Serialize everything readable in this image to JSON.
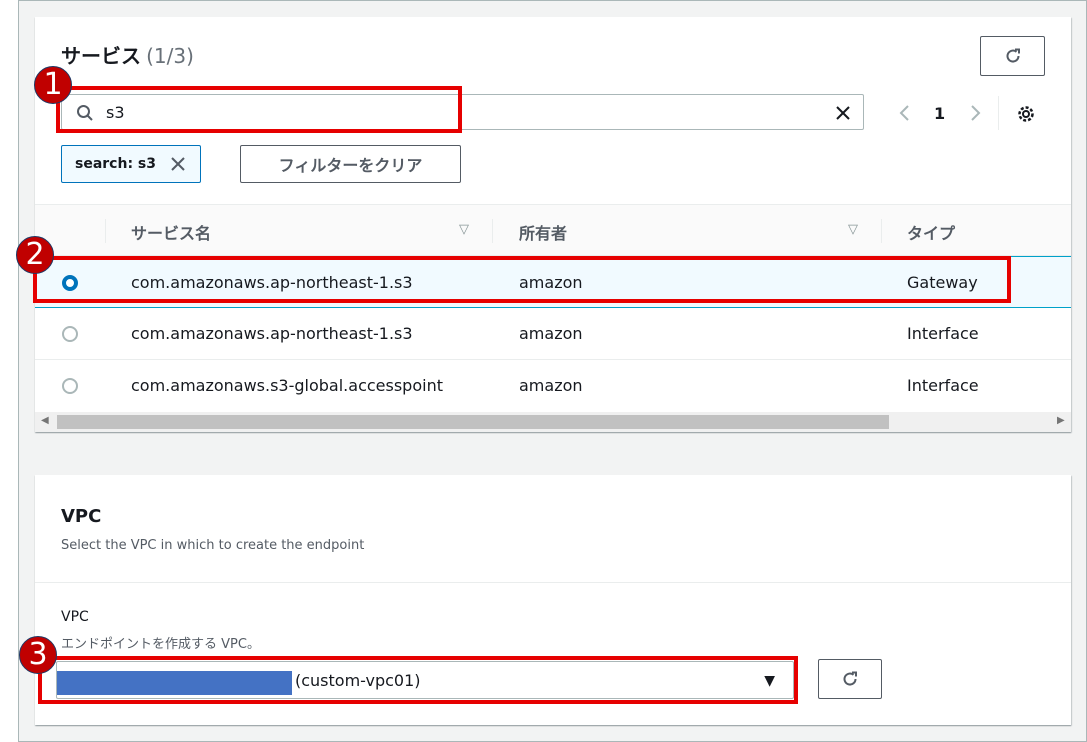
{
  "services_panel": {
    "title": "サービス",
    "count": "(1/3)",
    "search_value": "s3",
    "page_number": "1",
    "filter_tag": "search: s3",
    "clear_filters_label": "フィルターをクリア",
    "columns": [
      "サービス名",
      "所有者",
      "タイプ"
    ],
    "rows": [
      {
        "name": "com.amazonaws.ap-northeast-1.s3",
        "owner": "amazon",
        "type": "Gateway",
        "selected": true
      },
      {
        "name": "com.amazonaws.ap-northeast-1.s3",
        "owner": "amazon",
        "type": "Interface",
        "selected": false
      },
      {
        "name": "com.amazonaws.s3-global.accesspoint",
        "owner": "amazon",
        "type": "Interface",
        "selected": false
      }
    ]
  },
  "vpc_panel": {
    "heading": "VPC",
    "description": "Select the VPC in which to create the endpoint",
    "field_label": "VPC",
    "field_description": "エンドポイントを作成する VPC。",
    "selected_value": "(custom-vpc01)"
  },
  "annotations": [
    "1",
    "2",
    "3"
  ],
  "colors": {
    "accent": "#0073bb",
    "annotation_red": "#e60000",
    "badge_fill": "#c00000",
    "redaction_blue": "#4472c4"
  },
  "icons": [
    "search-icon",
    "clear-icon",
    "refresh-icon",
    "chevron-left-icon",
    "chevron-right-icon",
    "settings-icon",
    "sort-icon",
    "dropdown-caret-icon"
  ]
}
